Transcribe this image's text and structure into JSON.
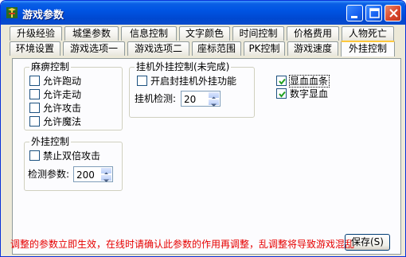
{
  "window": {
    "title": "游戏参数",
    "icon": "app-icon",
    "controls": [
      "minimize-icon",
      "maximize-icon",
      "close-icon"
    ]
  },
  "tabs": {
    "row1": [
      "升级经验",
      "城堡参数",
      "信息控制",
      "文字颜色",
      "时间控制",
      "价格费用",
      "人物死亡"
    ],
    "row2": [
      "环境设置",
      "游戏选项一",
      "游戏选项二",
      "座标范围",
      "PK控制",
      "游戏速度",
      "外挂控制"
    ],
    "active": "外挂控制"
  },
  "paralysis_group": {
    "title": "麻痹控制",
    "options": [
      {
        "label": "允许跑动",
        "checked": false
      },
      {
        "label": "允许走动",
        "checked": false
      },
      {
        "label": "允许攻击",
        "checked": false
      },
      {
        "label": "允许魔法",
        "checked": false
      }
    ]
  },
  "cheat_group": {
    "title": "外挂控制",
    "option": {
      "label": "禁止双倍攻击",
      "checked": false
    },
    "param_label": "检测参数:",
    "param_value": "200"
  },
  "autoplay_group": {
    "title": "挂机外挂控制(未完成)",
    "option": {
      "label": "开启封挂机外挂功能",
      "checked": false
    },
    "detect_label": "挂机检测:",
    "detect_value": "20"
  },
  "display_options": [
    {
      "label": "显血血条",
      "checked": true
    },
    {
      "label": "数字显血",
      "checked": true
    }
  ],
  "save_button": "保存(S)",
  "status_message": "调整的参数立即生效，在线时请确认此参数的作用再调整，乱调整将导致游戏混乱",
  "colors": {
    "title_bar": "#0054e3",
    "status_text": "#e60000",
    "tab_highlight": "#ffc83c"
  }
}
